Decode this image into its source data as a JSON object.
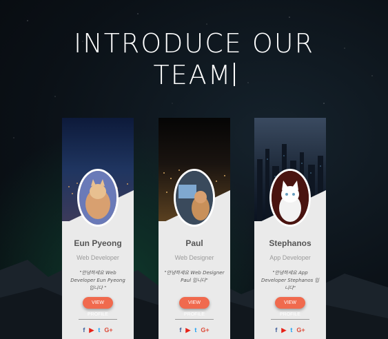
{
  "heading": {
    "line1": "INTRODUCE OUR",
    "line2": "TEAM"
  },
  "team": [
    {
      "name": "Eun Pyeong",
      "role": "Web Developer",
      "description": "\"안녕하세요 Web Developer Eun Pyeong 입니다 \"",
      "button_label": "VIEW PROFILE",
      "photo_icon": "cat-icon"
    },
    {
      "name": "Paul",
      "role": "Web Designer",
      "description": "\"안녕하세요 Web Designer Paul 입니다\"",
      "button_label": "VIEW PROFILE",
      "photo_icon": "cat-icon"
    },
    {
      "name": "Stephanos",
      "role": "App Developer",
      "description": "\"안녕하세요 App Developer Stephanos 입니다\"",
      "button_label": "VIEW PROFILE",
      "photo_icon": "cat-icon"
    }
  ],
  "social": {
    "facebook": "f",
    "youtube": "▶",
    "twitter": "t",
    "googleplus": "G+"
  },
  "colors": {
    "accent": "#f06a4e",
    "card_bg": "#eaeaea"
  }
}
